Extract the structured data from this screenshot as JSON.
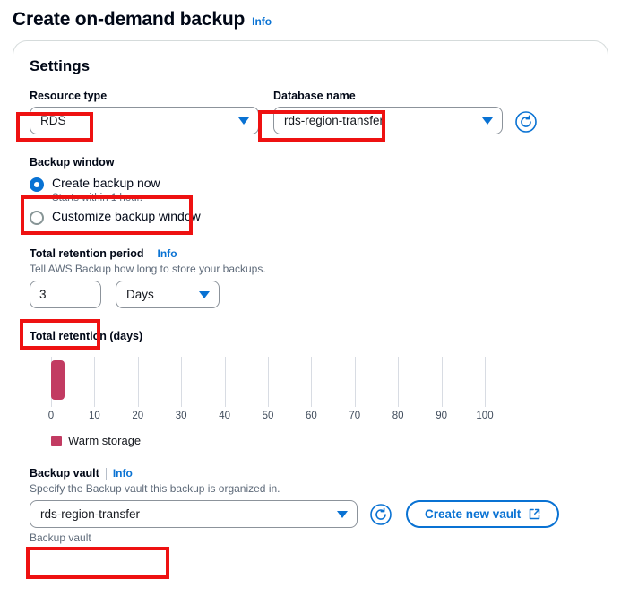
{
  "page": {
    "title": "Create on-demand backup",
    "info_label": "Info"
  },
  "card": {
    "title": "Settings"
  },
  "resource_type": {
    "label": "Resource type",
    "value": "RDS",
    "chevron_icon": "chevron-down-icon"
  },
  "database_name": {
    "label": "Database name",
    "value": "rds-region-transfer",
    "chevron_icon": "chevron-down-icon",
    "refresh_icon": "refresh-icon"
  },
  "backup_window": {
    "label": "Backup window",
    "options": [
      {
        "label": "Create backup now",
        "sublabel": "Starts within 1 hour.",
        "selected": true
      },
      {
        "label": "Customize backup window",
        "sublabel": "",
        "selected": false
      }
    ]
  },
  "retention_period": {
    "label": "Total retention period",
    "info_label": "Info",
    "description": "Tell AWS Backup how long to store your backups.",
    "value": "3",
    "unit": "Days",
    "chevron_icon": "chevron-down-icon"
  },
  "backup_vault": {
    "label": "Backup vault",
    "info_label": "Info",
    "description": "Specify the Backup vault this backup is organized in.",
    "value": "rds-region-transfer",
    "hint": "Backup vault",
    "chevron_icon": "chevron-down-icon",
    "refresh_icon": "refresh-icon",
    "create_button_label": "Create new vault",
    "external_icon": "external-link-icon"
  },
  "colors": {
    "accent": "#0972d3",
    "warm_storage": "#c23b62",
    "annotation": "#ee1111"
  },
  "chart_data": {
    "type": "bar",
    "title": "Total retention (days)",
    "categories": [
      "Warm storage"
    ],
    "values": [
      3
    ],
    "series": [
      {
        "name": "Warm storage",
        "values": [
          3
        ],
        "color": "#c23b62"
      }
    ],
    "xlabel": "",
    "ylabel": "",
    "xlim": [
      0,
      100
    ],
    "ticks": [
      0,
      10,
      20,
      30,
      40,
      50,
      60,
      70,
      80,
      90,
      100
    ],
    "grid": true,
    "legend": [
      "Warm storage"
    ],
    "legend_position": "bottom-left",
    "orientation": "horizontal-axis-days"
  }
}
